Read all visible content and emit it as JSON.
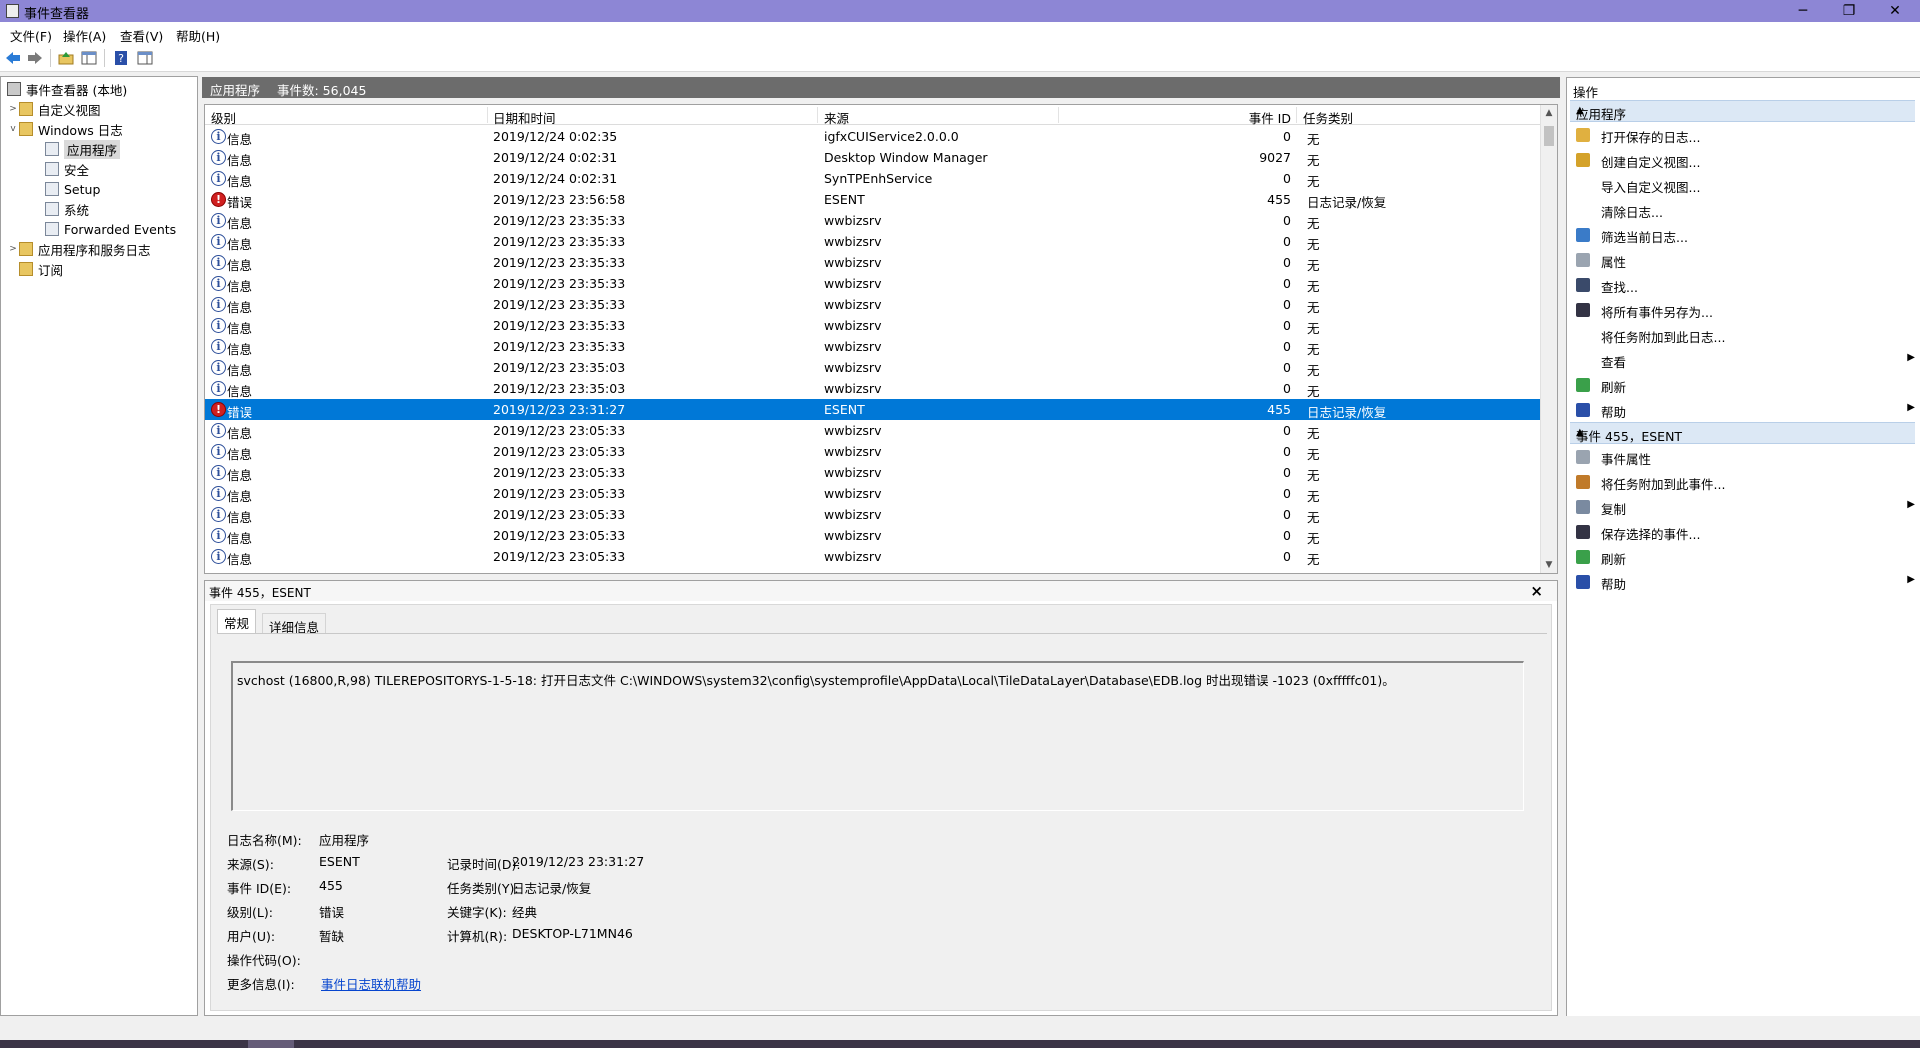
{
  "window": {
    "title": "事件查看器",
    "minimize": "─",
    "maximize": "❐",
    "close": "✕"
  },
  "menu": [
    "文件(F)",
    "操作(A)",
    "查看(V)",
    "帮助(H)"
  ],
  "tree": {
    "root": "事件查看器 (本地)",
    "custom_views": "自定义视图",
    "windows_logs": "Windows 日志",
    "logs": [
      "应用程序",
      "安全",
      "Setup",
      "系统",
      "Forwarded Events"
    ],
    "app_service_logs": "应用程序和服务日志",
    "subscriptions": "订阅"
  },
  "center": {
    "log_name": "应用程序",
    "event_count": "事件数: 56,045"
  },
  "columns": {
    "level": "级别",
    "date": "日期和时间",
    "source": "来源",
    "event_id": "事件 ID",
    "task": "任务类别"
  },
  "events": [
    {
      "level": "信息",
      "kind": "info",
      "date": "2019/12/24 0:02:35",
      "source": "igfxCUIService2.0.0.0",
      "id": "0",
      "task": "无"
    },
    {
      "level": "信息",
      "kind": "info",
      "date": "2019/12/24 0:02:31",
      "source": "Desktop Window Manager",
      "id": "9027",
      "task": "无"
    },
    {
      "level": "信息",
      "kind": "info",
      "date": "2019/12/24 0:02:31",
      "source": "SynTPEnhService",
      "id": "0",
      "task": "无"
    },
    {
      "level": "错误",
      "kind": "error",
      "date": "2019/12/23 23:56:58",
      "source": "ESENT",
      "id": "455",
      "task": "日志记录/恢复"
    },
    {
      "level": "信息",
      "kind": "info",
      "date": "2019/12/23 23:35:33",
      "source": "wwbizsrv",
      "id": "0",
      "task": "无"
    },
    {
      "level": "信息",
      "kind": "info",
      "date": "2019/12/23 23:35:33",
      "source": "wwbizsrv",
      "id": "0",
      "task": "无"
    },
    {
      "level": "信息",
      "kind": "info",
      "date": "2019/12/23 23:35:33",
      "source": "wwbizsrv",
      "id": "0",
      "task": "无"
    },
    {
      "level": "信息",
      "kind": "info",
      "date": "2019/12/23 23:35:33",
      "source": "wwbizsrv",
      "id": "0",
      "task": "无"
    },
    {
      "level": "信息",
      "kind": "info",
      "date": "2019/12/23 23:35:33",
      "source": "wwbizsrv",
      "id": "0",
      "task": "无"
    },
    {
      "level": "信息",
      "kind": "info",
      "date": "2019/12/23 23:35:33",
      "source": "wwbizsrv",
      "id": "0",
      "task": "无"
    },
    {
      "level": "信息",
      "kind": "info",
      "date": "2019/12/23 23:35:33",
      "source": "wwbizsrv",
      "id": "0",
      "task": "无"
    },
    {
      "level": "信息",
      "kind": "info",
      "date": "2019/12/23 23:35:03",
      "source": "wwbizsrv",
      "id": "0",
      "task": "无"
    },
    {
      "level": "信息",
      "kind": "info",
      "date": "2019/12/23 23:35:03",
      "source": "wwbizsrv",
      "id": "0",
      "task": "无"
    },
    {
      "level": "错误",
      "kind": "error",
      "date": "2019/12/23 23:31:27",
      "source": "ESENT",
      "id": "455",
      "task": "日志记录/恢复",
      "selected": true
    },
    {
      "level": "信息",
      "kind": "info",
      "date": "2019/12/23 23:05:33",
      "source": "wwbizsrv",
      "id": "0",
      "task": "无"
    },
    {
      "level": "信息",
      "kind": "info",
      "date": "2019/12/23 23:05:33",
      "source": "wwbizsrv",
      "id": "0",
      "task": "无"
    },
    {
      "level": "信息",
      "kind": "info",
      "date": "2019/12/23 23:05:33",
      "source": "wwbizsrv",
      "id": "0",
      "task": "无"
    },
    {
      "level": "信息",
      "kind": "info",
      "date": "2019/12/23 23:05:33",
      "source": "wwbizsrv",
      "id": "0",
      "task": "无"
    },
    {
      "level": "信息",
      "kind": "info",
      "date": "2019/12/23 23:05:33",
      "source": "wwbizsrv",
      "id": "0",
      "task": "无"
    },
    {
      "level": "信息",
      "kind": "info",
      "date": "2019/12/23 23:05:33",
      "source": "wwbizsrv",
      "id": "0",
      "task": "无"
    },
    {
      "level": "信息",
      "kind": "info",
      "date": "2019/12/23 23:05:33",
      "source": "wwbizsrv",
      "id": "0",
      "task": "无"
    }
  ],
  "detail": {
    "title": "事件 455，ESENT",
    "tabs": [
      "常规",
      "详细信息"
    ],
    "message": "svchost (16800,R,98) TILEREPOSITORYS-1-5-18: 打开日志文件 C:\\WINDOWS\\system32\\config\\systemprofile\\AppData\\Local\\TileDataLayer\\Database\\EDB.log 时出现错误 -1023 (0xfffffc01)。",
    "labels": {
      "log_name": "日志名称(M):",
      "source": "来源(S):",
      "event_id": "事件 ID(E):",
      "level": "级别(L):",
      "user": "用户(U):",
      "opcode": "操作代码(O):",
      "more_info": "更多信息(I):",
      "logged": "记录时间(D):",
      "task": "任务类别(Y):",
      "keywords": "关键字(K):",
      "computer": "计算机(R):"
    },
    "values": {
      "log_name": "应用程序",
      "source": "ESENT",
      "event_id": "455",
      "level": "错误",
      "user": "暂缺",
      "opcode": "",
      "more_info": "事件日志联机帮助",
      "logged": "2019/12/23 23:31:27",
      "task": "日志记录/恢复",
      "keywords": "经典",
      "computer": "DESKTOP-L71MN46"
    }
  },
  "actions": {
    "title": "操作",
    "section1": "应用程序",
    "items1": [
      "打开保存的日志...",
      "创建自定义视图...",
      "导入自定义视图...",
      "清除日志...",
      "筛选当前日志...",
      "属性",
      "查找...",
      "将所有事件另存为...",
      "将任务附加到此日志...",
      "查看",
      "刷新",
      "帮助"
    ],
    "section2": "事件 455，ESENT",
    "items2": [
      "事件属性",
      "将任务附加到此事件...",
      "复制",
      "保存选择的事件...",
      "刷新",
      "帮助"
    ]
  },
  "colors": {
    "titlebar": "#8d86d5",
    "selection": "#0078d7",
    "section": "#dce8f5"
  }
}
